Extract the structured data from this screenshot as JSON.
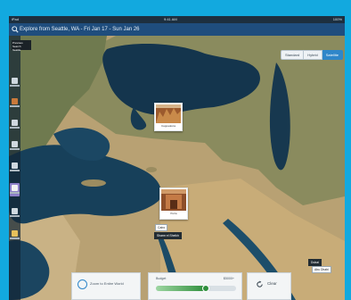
{
  "colors": {
    "frame": "#12a9df",
    "header": "#1f4d7d",
    "accent": "#2f86c9",
    "sidebar_active": "#8d7fc8",
    "budget_fill": "#2f8f3c"
  },
  "status_bar": {
    "left": "iPad",
    "time": "9:41 AM",
    "right": "100%"
  },
  "header": {
    "icon": "search-icon",
    "title": "Explore from Seattle, WA - Fri Jan 17 - Sun Jan 26"
  },
  "map_type": {
    "options": [
      "Standard",
      "Hybrid",
      "Satellite"
    ],
    "selected": "Satellite"
  },
  "origin_box": {
    "line1": "Previous Search",
    "line2": "Seattle"
  },
  "sidebar": {
    "items": [
      {
        "icon": "plane-icon",
        "active": false
      },
      {
        "icon": "heart-icon",
        "active": false
      },
      {
        "icon": "hotel-icon",
        "active": false
      },
      {
        "icon": "person-icon",
        "active": false
      },
      {
        "icon": "list-icon",
        "active": false
      },
      {
        "icon": "beach-icon",
        "active": true
      },
      {
        "icon": "mountain-icon",
        "active": false
      },
      {
        "icon": "hiker-icon",
        "active": false
      }
    ]
  },
  "pins": [
    {
      "caption": "Cappadocia"
    },
    {
      "caption": "Petra"
    }
  ],
  "chips": [
    {
      "text": "Cairo",
      "style": "light"
    },
    {
      "text": "Sharm el Sheikh",
      "style": "dark"
    },
    {
      "text": "Dubai",
      "style": "dark"
    },
    {
      "text": "Abu Dhabi",
      "style": "light"
    }
  ],
  "zoom": {
    "icon": "check-circle-icon",
    "label": "Zoom to Entire World"
  },
  "budget": {
    "label": "Budget",
    "amount": "$5000+",
    "level_fraction": 0.62
  },
  "clear": {
    "icon": "refresh-icon",
    "label": "Clear"
  }
}
